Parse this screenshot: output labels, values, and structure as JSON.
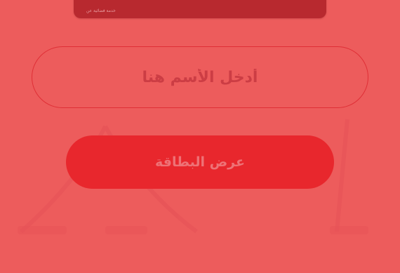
{
  "card_preview": {
    "caption": "خدمة فضائية عن"
  },
  "name_input": {
    "value": "",
    "placeholder": "أدخل الأسم هنا"
  },
  "actions": {
    "show_card_label": "عرض البطاقة"
  },
  "colors": {
    "background": "#ed5c5c",
    "card": "#b8292f",
    "input_border": "#df2f36",
    "button": "#e8272d",
    "button_text": "#ee7276",
    "placeholder_text": "#cc3d44"
  }
}
